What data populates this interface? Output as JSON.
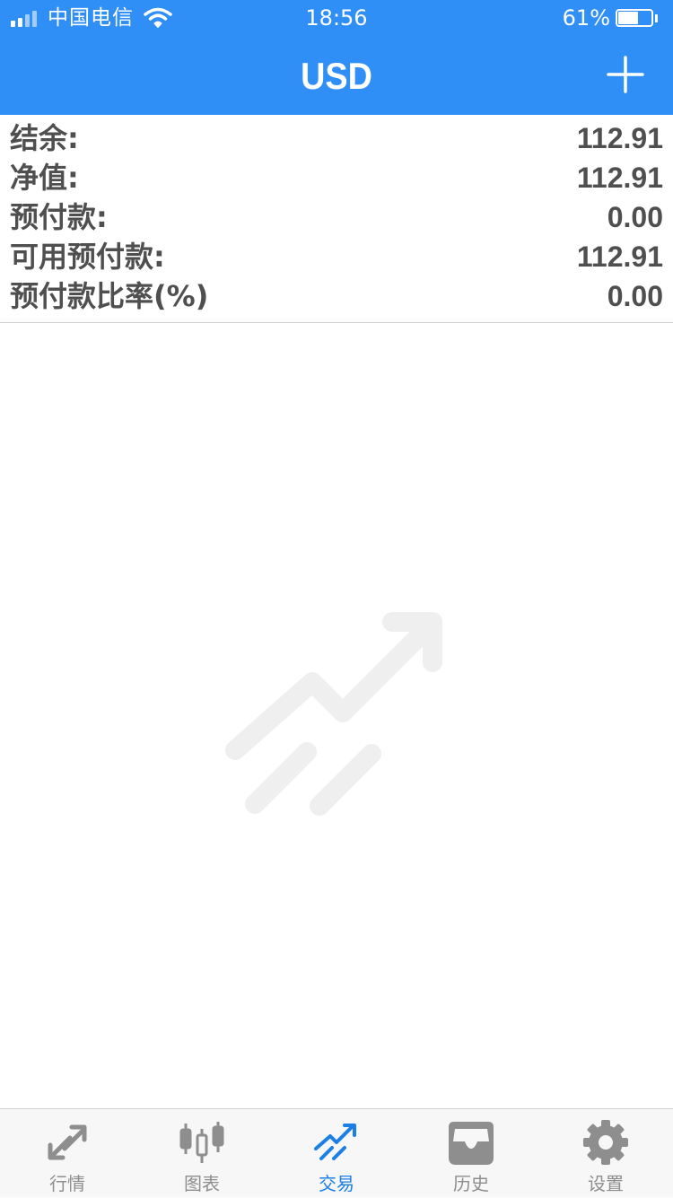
{
  "status_bar": {
    "carrier": "中国电信",
    "time": "18:56",
    "battery_percent": "61%",
    "battery_level": 0.61
  },
  "nav": {
    "title": "USD",
    "add_icon": "plus-icon"
  },
  "account": {
    "rows": [
      {
        "label": "结余:",
        "value": "112.91"
      },
      {
        "label": "净值:",
        "value": "112.91"
      },
      {
        "label": "预付款:",
        "value": "0.00"
      },
      {
        "label": "可用预付款:",
        "value": "112.91"
      },
      {
        "label": "预付款比率(%)",
        "value": "0.00"
      }
    ]
  },
  "empty_state": {
    "icon": "trade-arrow-illustration"
  },
  "tabbar": {
    "tabs": [
      {
        "label": "行情",
        "icon": "quotes-arrows-icon",
        "active": false
      },
      {
        "label": "图表",
        "icon": "candlestick-chart-icon",
        "active": false
      },
      {
        "label": "交易",
        "icon": "trade-arrow-icon",
        "active": true
      },
      {
        "label": "历史",
        "icon": "history-inbox-icon",
        "active": false
      },
      {
        "label": "设置",
        "icon": "gear-icon",
        "active": false
      }
    ]
  },
  "colors": {
    "header_bg": "#2f8ff7",
    "text_dark": "#4f4f4f",
    "tab_active": "#1b7fe6",
    "tab_inactive": "#8e8e8e",
    "illustration": "#efefef"
  }
}
